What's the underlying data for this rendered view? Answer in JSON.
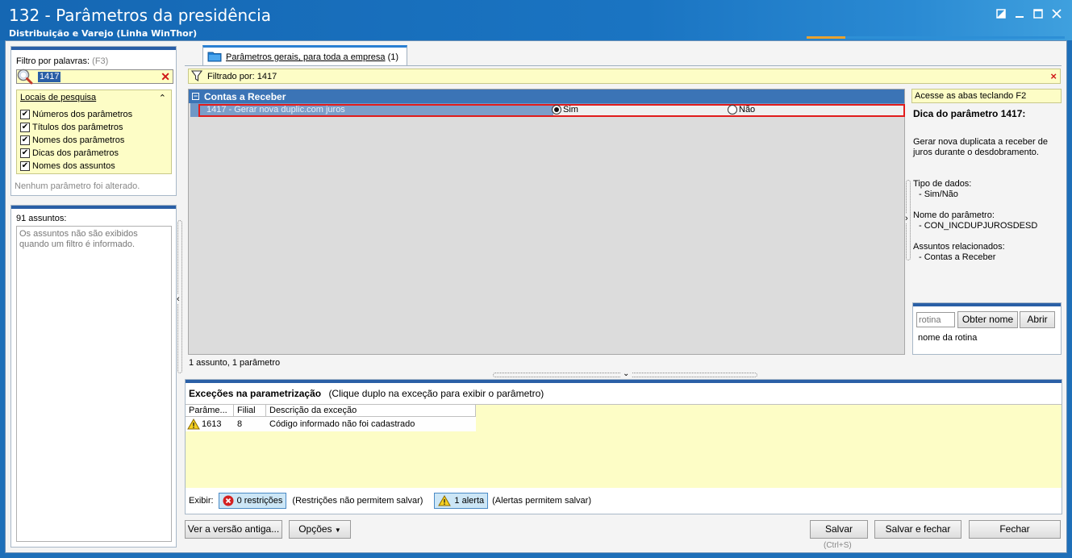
{
  "window": {
    "title": "132 - Parâmetros da presidência",
    "subtitle": "Distribuição e Varejo (Linha WinThor)"
  },
  "filter": {
    "label": "Filtro por palavras:",
    "shortcut": "(F3)",
    "value": "1417",
    "locais_header": "Locais de pesquisa",
    "options": [
      {
        "label": "Números dos parâmetros",
        "checked": true
      },
      {
        "label": "Títulos dos parâmetros",
        "checked": true
      },
      {
        "label": "Nomes dos parâmetros",
        "checked": true
      },
      {
        "label": "Dicas dos parâmetros",
        "checked": true
      },
      {
        "label": "Nomes dos assuntos",
        "checked": true
      }
    ],
    "status": "Nenhum parâmetro foi alterado."
  },
  "assuntos": {
    "header": "91 assuntos:",
    "message": "Os assuntos não são exibidos quando um filtro é informado."
  },
  "tab": {
    "label": "Parâmetros gerais, para toda a empresa",
    "count": "(1)"
  },
  "filtered_bar": {
    "text": "Filtrado por: 1417"
  },
  "grid": {
    "group": "Contas a Receber",
    "row": {
      "label": "1417 - Gerar nova duplic.com juros",
      "option_yes": "Sim",
      "option_no": "Não",
      "selected": "Sim"
    },
    "status": "1 assunto, 1 parâmetro"
  },
  "tip": {
    "access": "Acesse as abas teclando F2",
    "title": "Dica do parâmetro 1417:",
    "description": "Gerar nova duplicata a receber de juros durante o desdobramento.",
    "type_label": "Tipo de dados:",
    "type_value": "- Sim/Não",
    "name_label": "Nome do parâmetro:",
    "name_value": "- CON_INCDUPJUROSDESD",
    "related_label": "Assuntos relacionados:",
    "related_value": "- Contas a Receber"
  },
  "rotina": {
    "placeholder": "rotina",
    "get_name": "Obter nome",
    "open": "Abrir",
    "name_label": "nome da rotina"
  },
  "exceptions": {
    "title": "Exceções na parametrização",
    "hint": "(Clique duplo na exceção para exibir o parâmetro)",
    "columns": [
      "Parâme...",
      "Filial",
      "Descrição da exceção"
    ],
    "rows": [
      {
        "param": "1613",
        "filial": "8",
        "descricao": "Código informado não foi cadastrado"
      }
    ],
    "exibir": "Exibir:",
    "restricoes_btn": "0 restrições",
    "restricoes_note": "(Restrições não permitem salvar)",
    "alertas_btn": "1 alerta",
    "alertas_note": "(Alertas permitem salvar)"
  },
  "footer": {
    "old_version": "Ver a versão antiga...",
    "options": "Opções",
    "save": "Salvar",
    "save_shortcut": "(Ctrl+S)",
    "save_close": "Salvar e fechar",
    "close": "Fechar"
  },
  "colors": {
    "title_blue": "#1a74c2",
    "panel_bar": "#2a5fa6",
    "highlight_yellow": "#fdfdc6",
    "group_blue": "#3b74b6",
    "selection_red": "#e11c1c"
  }
}
